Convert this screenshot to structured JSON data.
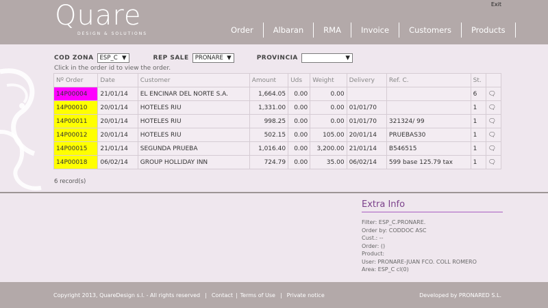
{
  "header": {
    "logo": "Quare",
    "logo_sub": "DESIGN & SOLUTIONS",
    "exit": "Exit",
    "nav": [
      "Order",
      "Albaran",
      "RMA",
      "Invoice",
      "Customers",
      "Products"
    ]
  },
  "filters": {
    "cod_zona_label": "COD ZONA",
    "cod_zona_value": "ESP_C",
    "rep_sale_label": "REP SALE",
    "rep_sale_value": "PRONARE",
    "provincia_label": "PROVINCIA",
    "provincia_value": ""
  },
  "hint": "Click in the order id to view the order.",
  "table": {
    "headers": [
      "Nº Order",
      "Date",
      "Customer",
      "Amount",
      "Uds",
      "Weight",
      "Delivery",
      "Ref. C.",
      "St.",
      ""
    ],
    "rows": [
      {
        "id": "14P00004",
        "date": "21/01/14",
        "customer": "EL ENCINAR DEL NORTE S.A.",
        "amount": "1,664.05",
        "uds": "0.00",
        "weight": "0.00",
        "delivery": "",
        "ref": "",
        "st": "6",
        "highlight": "magenta"
      },
      {
        "id": "14P00010",
        "date": "20/01/14",
        "customer": "HOTELES RIU",
        "amount": "1,331.00",
        "uds": "0.00",
        "weight": "0.00",
        "delivery": "01/01/70",
        "ref": "",
        "st": "1",
        "highlight": "yellow"
      },
      {
        "id": "14P00011",
        "date": "20/01/14",
        "customer": "HOTELES RIU",
        "amount": "998.25",
        "uds": "0.00",
        "weight": "0.00",
        "delivery": "01/01/70",
        "ref": "321324/ 99",
        "st": "1",
        "highlight": "yellow"
      },
      {
        "id": "14P00012",
        "date": "20/01/14",
        "customer": "HOTELES RIU",
        "amount": "502.15",
        "uds": "0.00",
        "weight": "105.00",
        "delivery": "20/01/14",
        "ref": "PRUEBAS30",
        "st": "1",
        "highlight": "yellow"
      },
      {
        "id": "14P00015",
        "date": "21/01/14",
        "customer": "SEGUNDA PRUEBA",
        "amount": "1,016.40",
        "uds": "0.00",
        "weight": "3,200.00",
        "delivery": "21/01/14",
        "ref": "B546515",
        "st": "1",
        "highlight": "yellow"
      },
      {
        "id": "14P00018",
        "date": "06/02/14",
        "customer": "GROUP HOLLIDAY INN",
        "amount": "724.79",
        "uds": "0.00",
        "weight": "35.00",
        "delivery": "06/02/14",
        "ref": "599 base 125.79 tax",
        "st": "1",
        "highlight": "yellow"
      }
    ]
  },
  "records": "6 record(s)",
  "extra_info": {
    "title": "Extra Info",
    "lines": [
      "Filter: ESP_C.PRONARE.",
      "Order by: CODDOC ASC",
      "Cust.: --",
      "Order: ()",
      "Product:",
      "User: PRONARE-JUAN FCO. COLL ROMERO",
      "Area: ESP_C cl(0)"
    ]
  },
  "footer": {
    "copyright": "Copyright 2013, QuareDesign s.l. - All rights reserved",
    "contact": "Contact",
    "terms": "Terms of Use",
    "privacy": "Private notice",
    "developed": "Developed by PRONARED S.L."
  },
  "colors": {
    "header_bg": "#b3a9a9",
    "page_bg": "#efe7ee",
    "highlight_yellow": "#ffff00",
    "highlight_magenta": "#ff00ff",
    "extra_title": "#7a3f8a"
  }
}
